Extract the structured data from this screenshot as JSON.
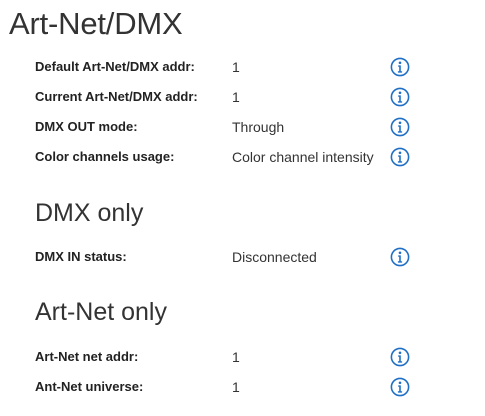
{
  "page": {
    "title": "Art-Net/DMX"
  },
  "colors": {
    "info_icon": "#1f6fc5",
    "text": "#222222"
  },
  "sections": {
    "artnet_dmx": {
      "rows": [
        {
          "label": "Default Art-Net/DMX addr:",
          "value": "1",
          "icon": "info-icon"
        },
        {
          "label": "Current Art-Net/DMX addr:",
          "value": "1",
          "icon": "info-icon"
        },
        {
          "label": "DMX OUT mode:",
          "value": "Through",
          "icon": "info-icon"
        },
        {
          "label": "Color channels usage:",
          "value": "Color channel intensity",
          "icon": "info-icon"
        }
      ]
    },
    "dmx_only": {
      "title": "DMX only",
      "rows": [
        {
          "label": "DMX IN status:",
          "value": "Disconnected",
          "icon": "info-icon"
        }
      ]
    },
    "artnet_only": {
      "title": "Art-Net only",
      "rows": [
        {
          "label": "Art-Net net addr:",
          "value": "1",
          "icon": "info-icon"
        },
        {
          "label": "Ant-Net universe:",
          "value": "1",
          "icon": "info-icon"
        }
      ]
    }
  }
}
